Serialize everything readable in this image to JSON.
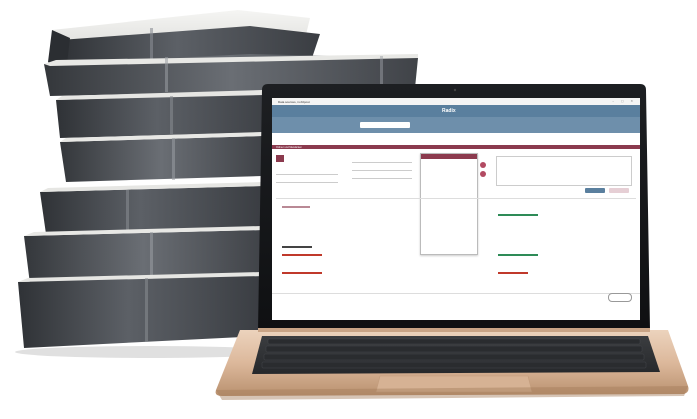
{
  "screen": {
    "window_title": "Data sources, in-Kilpost",
    "app_logo": "Radix",
    "section_title": "Ordner und Mandanten"
  }
}
